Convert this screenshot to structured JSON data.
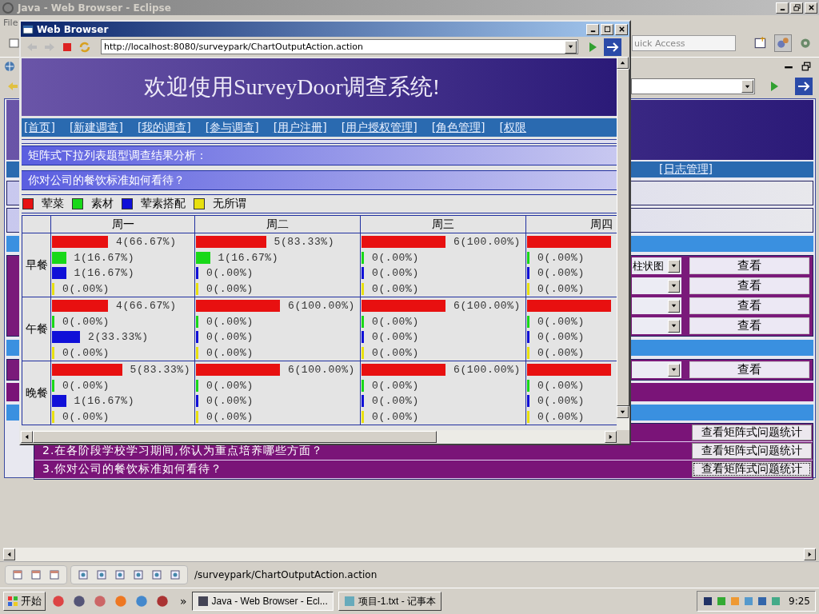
{
  "eclipse": {
    "title": "Java - Web Browser - Eclipse",
    "menu": [
      "File"
    ],
    "quick_access": {
      "placeholder": "uick Access"
    },
    "page": {
      "nav": [
        "[日志管理]"
      ],
      "chart_groups": [
        [
          {
            "select": "柱状图",
            "button": "查看"
          },
          {
            "button": "查看"
          },
          {
            "button": "查看"
          },
          {
            "button": "查看"
          }
        ],
        [
          {
            "button": "查看"
          }
        ]
      ],
      "matrix_rows": [
        {
          "button": "查看矩阵式问题统计",
          "focused": false
        },
        {
          "text": "2.在各阶段学校学习期间,你认为重点培养哪些方面？",
          "button": "查看矩阵式问题统计",
          "focused": false
        },
        {
          "text": "3.你对公司的餐饮标准如何看待？",
          "button": "查看矩阵式问题统计",
          "focused": true
        }
      ]
    },
    "status": "/surveypark/ChartOutputAction.action"
  },
  "popup": {
    "title": "Web Browser",
    "url": "http://localhost:8080/surveypark/ChartOutputAction.action",
    "heading": "欢迎使用SurveyDoor调查系统!",
    "nav": [
      "[首页]",
      "[新建调查]",
      "[我的调查]",
      "[参与调查]",
      "[用户注册]",
      "[用户授权管理]",
      "[角色管理]",
      "[权限"
    ],
    "section_title": "矩阵式下拉列表题型调查结果分析：",
    "question": "你对公司的餐饮标准如何看待？",
    "legend": [
      {
        "label": "荤菜",
        "color": "#e81010"
      },
      {
        "label": "素材",
        "color": "#18d818"
      },
      {
        "label": "荤素搭配",
        "color": "#1010d8"
      },
      {
        "label": "无所谓",
        "color": "#e8e010"
      }
    ],
    "columns": [
      "周一",
      "周二",
      "周三",
      "周四"
    ],
    "rows": [
      {
        "label": "早餐",
        "cells": [
          {
            "bars": [
              {
                "kind": "labeled",
                "reading": "4(66.67%)"
              },
              {
                "kind": "labeled",
                "reading": "1(16.67%)"
              },
              {
                "kind": "labeled",
                "reading": "1(16.67%)"
              },
              {
                "kind": "labeled",
                "reading": "0(.00%)"
              }
            ]
          },
          {
            "bars": [
              {
                "kind": "labeled",
                "reading": "5(83.33%)"
              },
              {
                "kind": "labeled",
                "reading": "1(16.67%)"
              },
              {
                "kind": "labeled",
                "reading": "0(.00%)"
              },
              {
                "kind": "labeled",
                "reading": "0(.00%)"
              }
            ]
          },
          {
            "bars": [
              {
                "kind": "labeled",
                "reading": "6(100.00%)"
              },
              {
                "kind": "labeled",
                "reading": "0(.00%)"
              },
              {
                "kind": "labeled",
                "reading": "0(.00%)"
              },
              {
                "kind": "labeled",
                "reading": "0(.00%)"
              }
            ]
          },
          {
            "bars": [
              {
                "kind": "unlabeled"
              },
              {
                "kind": "labeled",
                "reading": "0(.00%)"
              },
              {
                "kind": "labeled",
                "reading": "0(.00%)"
              },
              {
                "kind": "labeled",
                "reading": "0(.00%)"
              }
            ]
          }
        ]
      },
      {
        "label": "午餐",
        "cells": [
          {
            "bars": [
              {
                "kind": "labeled",
                "reading": "4(66.67%)"
              },
              {
                "kind": "labeled",
                "reading": "0(.00%)"
              },
              {
                "kind": "labeled",
                "reading": "2(33.33%)"
              },
              {
                "kind": "labeled",
                "reading": "0(.00%)"
              }
            ]
          },
          {
            "bars": [
              {
                "kind": "labeled",
                "reading": "6(100.00%)"
              },
              {
                "kind": "labeled",
                "reading": "0(.00%)"
              },
              {
                "kind": "labeled",
                "reading": "0(.00%)"
              },
              {
                "kind": "labeled",
                "reading": "0(.00%)"
              }
            ]
          },
          {
            "bars": [
              {
                "kind": "labeled",
                "reading": "6(100.00%)"
              },
              {
                "kind": "labeled",
                "reading": "0(.00%)"
              },
              {
                "kind": "labeled",
                "reading": "0(.00%)"
              },
              {
                "kind": "labeled",
                "reading": "0(.00%)"
              }
            ]
          },
          {
            "bars": [
              {
                "kind": "unlabeled"
              },
              {
                "kind": "labeled",
                "reading": "0(.00%)"
              },
              {
                "kind": "labeled",
                "reading": "0(.00%)"
              },
              {
                "kind": "labeled",
                "reading": "0(.00%)"
              }
            ]
          }
        ]
      },
      {
        "label": "晚餐",
        "cells": [
          {
            "bars": [
              {
                "kind": "labeled",
                "reading": "5(83.33%)"
              },
              {
                "kind": "labeled",
                "reading": "0(.00%)"
              },
              {
                "kind": "labeled",
                "reading": "1(16.67%)"
              },
              {
                "kind": "labeled",
                "reading": "0(.00%)"
              }
            ]
          },
          {
            "bars": [
              {
                "kind": "labeled",
                "reading": "6(100.00%)"
              },
              {
                "kind": "labeled",
                "reading": "0(.00%)"
              },
              {
                "kind": "labeled",
                "reading": "0(.00%)"
              },
              {
                "kind": "labeled",
                "reading": "0(.00%)"
              }
            ]
          },
          {
            "bars": [
              {
                "kind": "labeled",
                "reading": "6(100.00%)"
              },
              {
                "kind": "labeled",
                "reading": "0(.00%)"
              },
              {
                "kind": "labeled",
                "reading": "0(.00%)"
              },
              {
                "kind": "labeled",
                "reading": "0(.00%)"
              }
            ]
          },
          {
            "bars": [
              {
                "kind": "unlabeled"
              },
              {
                "kind": "labeled",
                "reading": "0(.00%)"
              },
              {
                "kind": "labeled",
                "reading": "0(.00%)"
              },
              {
                "kind": "labeled",
                "reading": "0(.00%)"
              }
            ]
          }
        ]
      }
    ]
  },
  "taskbar": {
    "start": "开始",
    "chevron": "»",
    "tasks": [
      {
        "label": "Java - Web Browser - Ecl...",
        "selected": true
      },
      {
        "label": "项目-1.txt - 记事本",
        "selected": false
      }
    ],
    "clock": "9:25"
  }
}
